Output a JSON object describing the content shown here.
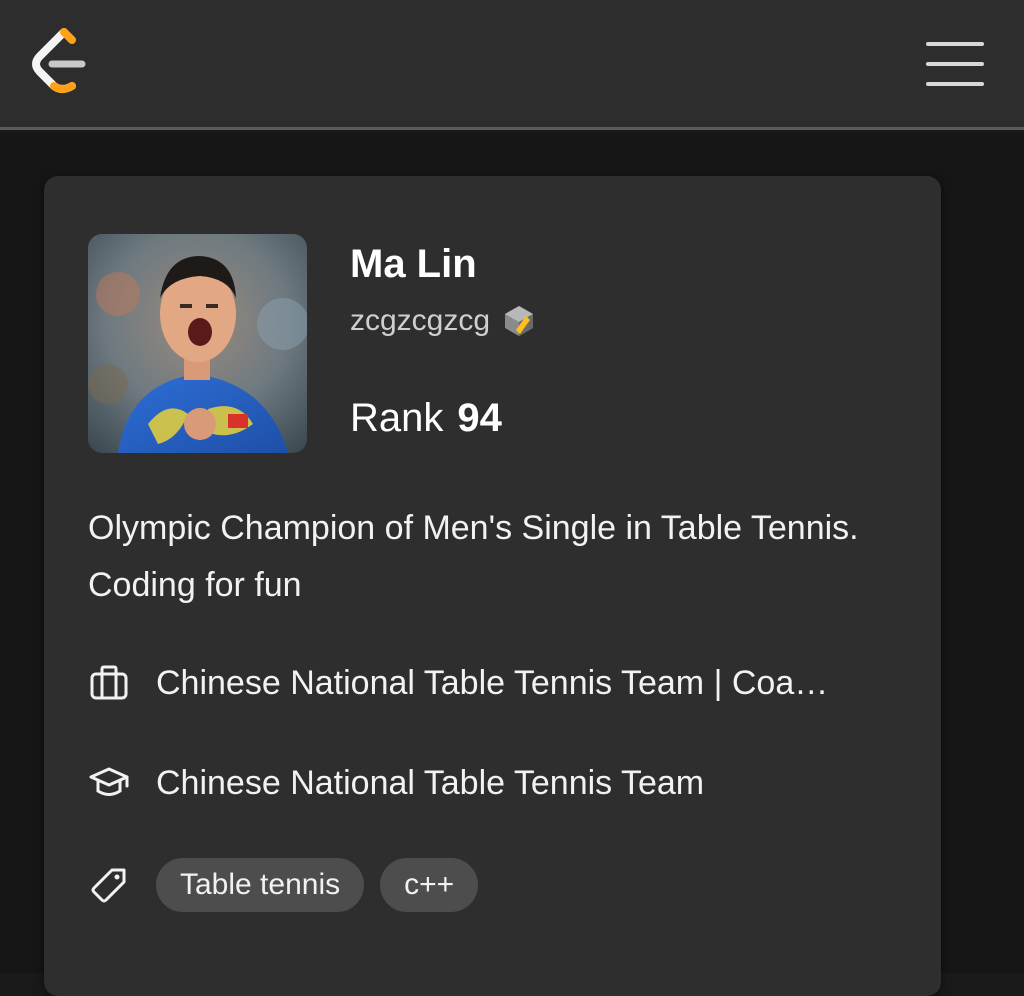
{
  "header": {
    "logo_icon": "leetcode-logo-icon",
    "menu_icon": "hamburger-menu-icon",
    "accent": "#ffa116"
  },
  "profile": {
    "name": "Ma Lin",
    "username": "zcgzcgzcg",
    "badge_icon": "cube-badge-icon",
    "rank_label": "Rank",
    "rank_value": "94",
    "bio": "Olympic Champion of Men's Single in Table Tennis. Coding for fun",
    "company": "Chinese National Table Tennis Team | Coa…",
    "company_icon": "briefcase-icon",
    "school": "Chinese National Table Tennis Team",
    "school_icon": "graduation-cap-icon",
    "tags_icon": "tag-icon",
    "tags": [
      "Table tennis",
      "c++"
    ]
  }
}
